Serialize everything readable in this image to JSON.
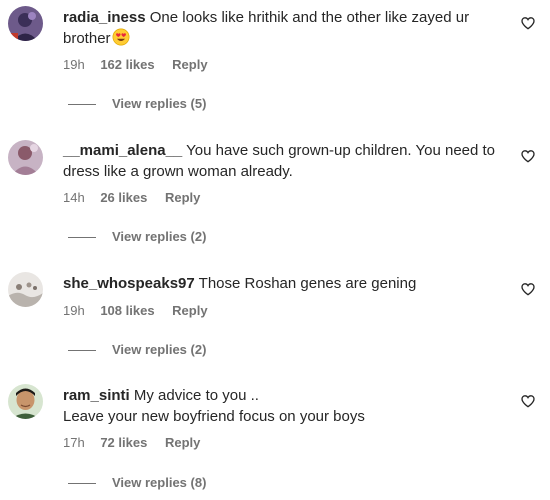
{
  "comments": [
    {
      "username": "radia_iness",
      "text": "One looks like hrithik and the other like zayed ur brother",
      "emoji": "heart-eyes-emoji",
      "time": "19h",
      "likes": "162 likes",
      "reply": "Reply",
      "view_replies": "View replies (5)"
    },
    {
      "username": "__mami_alena__",
      "text": "You have such grown-up children. You need to dress like a grown woman already.",
      "time": "14h",
      "likes": "26 likes",
      "reply": "Reply",
      "view_replies": "View replies (2)"
    },
    {
      "username": "she_whospeaks97",
      "text": "Those Roshan genes are gening",
      "time": "19h",
      "likes": "108 likes",
      "reply": "Reply",
      "view_replies": "View replies (2)"
    },
    {
      "username": "ram_sinti",
      "text_line1": "My advice to you ..",
      "text_line2": "Leave your new boyfriend focus on your boys",
      "time": "17h",
      "likes": "72 likes",
      "reply": "Reply",
      "view_replies": "View replies (8)"
    }
  ],
  "icons": {
    "like": "heart-outline-icon"
  },
  "colors": {
    "primary_text": "#262626",
    "secondary_text": "#737373"
  }
}
